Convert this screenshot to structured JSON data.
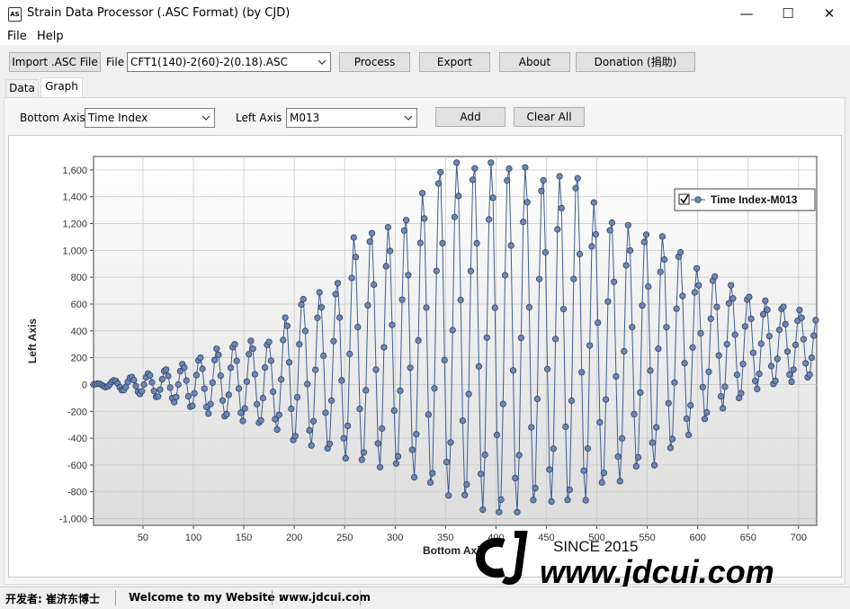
{
  "window": {
    "title": "Strain Data Processor (.ASC Format) (by CJD)",
    "icon": "app-logo-icon",
    "controls": {
      "minimize": "—",
      "maximize": "☐",
      "close": "✕"
    }
  },
  "menu": {
    "file": "File",
    "help": "Help"
  },
  "toolbar": {
    "import_label": "Import .ASC File",
    "file_label": "File",
    "file_value": "CFT1(140)-2(60)-2(0.18).ASC",
    "process_label": "Process",
    "export_label": "Export",
    "about_label": "About",
    "donation_label": "Donation (捐助)"
  },
  "tabs": [
    {
      "label": "Data",
      "active": false
    },
    {
      "label": "Graph",
      "active": true
    }
  ],
  "graph_controls": {
    "bottom_axis_label": "Bottom Axis",
    "bottom_axis_value": "Time Index",
    "left_axis_label": "Left Axis",
    "left_axis_value": "M013",
    "add_label": "Add",
    "clear_label": "Clear All"
  },
  "chart_data": {
    "type": "line",
    "title": "",
    "xlabel": "Bottom Axis",
    "ylabel": "Left Axis",
    "xlim": [
      1,
      718
    ],
    "ylim": [
      -1050,
      1700
    ],
    "x_ticks": [
      "50",
      "100",
      "150",
      "200",
      "250",
      "300",
      "350",
      "400",
      "450",
      "500",
      "550",
      "600",
      "650",
      "700"
    ],
    "y_ticks": [
      "1,600",
      "1,400",
      "1,200",
      "1,000",
      "800",
      "600",
      "400",
      "200",
      "0",
      "-200",
      "-400",
      "-600",
      "-800",
      "-1,000"
    ],
    "grid": true,
    "legend_position": "top-right",
    "series": [
      {
        "name": "Time Index-M013",
        "color": "#3f5b8f",
        "marker": "circle"
      }
    ],
    "envelope": {
      "x": [
        1,
        20,
        40,
        60,
        80,
        100,
        120,
        140,
        160,
        180,
        200,
        220,
        240,
        260,
        280,
        300,
        320,
        340,
        360,
        380,
        400,
        420,
        440,
        460,
        480,
        500,
        520,
        540,
        560,
        580,
        600,
        620,
        640,
        660,
        680,
        700,
        718
      ],
      "upper": [
        0,
        30,
        60,
        90,
        130,
        180,
        260,
        310,
        330,
        330,
        640,
        680,
        720,
        1120,
        1170,
        1180,
        1330,
        1620,
        1660,
        1660,
        1660,
        1660,
        1580,
        1550,
        1600,
        1320,
        1220,
        1170,
        1130,
        1040,
        860,
        820,
        700,
        640,
        600,
        560,
        500
      ],
      "lower": [
        0,
        -30,
        -60,
        -90,
        -130,
        -180,
        -230,
        -260,
        -290,
        -320,
        -440,
        -460,
        -520,
        -580,
        -620,
        -620,
        -700,
        -800,
        -850,
        -900,
        -1010,
        -960,
        -900,
        -870,
        -940,
        -780,
        -740,
        -640,
        -600,
        -450,
        -320,
        -200,
        -120,
        -30,
        0,
        30,
        60
      ],
      "center": [
        0,
        0,
        0,
        0,
        0,
        0,
        20,
        30,
        30,
        10,
        100,
        110,
        100,
        270,
        280,
        280,
        320,
        410,
        410,
        380,
        330,
        350,
        340,
        340,
        330,
        270,
        240,
        260,
        260,
        300,
        270,
        310,
        290,
        300,
        300,
        300,
        280
      ]
    },
    "cycle_length": 17
  },
  "status": {
    "developer": "开发者: 崔济东博士",
    "welcome": "Welcome to my Website :",
    "website": "www.jdcui.com"
  },
  "watermark": {
    "since": "SINCE 2015",
    "site": "www.jdcui.com"
  }
}
